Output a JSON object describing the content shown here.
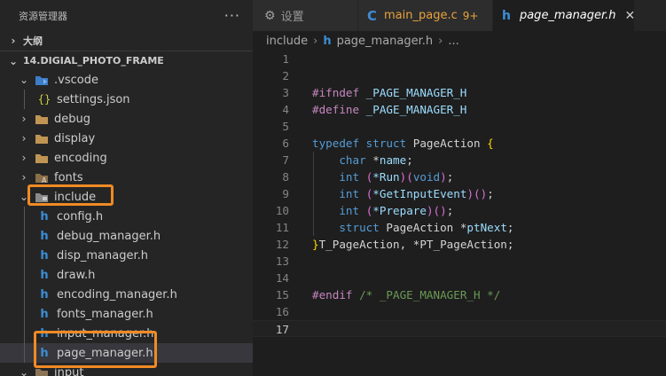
{
  "sidebar": {
    "title": "资源管理器",
    "more": "···",
    "outline_label": "大纲",
    "project_label": "14.DIGIAL_PHOTO_FRAME",
    "items": [
      {
        "label": ".vscode",
        "type": "folder-open",
        "icon": "vscode-folder-icon"
      },
      {
        "label": "settings.json",
        "type": "file",
        "icon": "json-icon",
        "glyph": "{}"
      },
      {
        "label": "debug",
        "type": "folder",
        "icon": "folder-icon"
      },
      {
        "label": "display",
        "type": "folder",
        "icon": "folder-icon"
      },
      {
        "label": "encoding",
        "type": "folder",
        "icon": "folder-icon"
      },
      {
        "label": "fonts",
        "type": "folder",
        "icon": "fonts-folder-icon"
      },
      {
        "label": "include",
        "type": "folder-open",
        "icon": "include-folder-icon"
      },
      {
        "label": "config.h",
        "type": "file",
        "icon": "h-icon"
      },
      {
        "label": "debug_manager.h",
        "type": "file",
        "icon": "h-icon"
      },
      {
        "label": "disp_manager.h",
        "type": "file",
        "icon": "h-icon"
      },
      {
        "label": "draw.h",
        "type": "file",
        "icon": "h-icon"
      },
      {
        "label": "encoding_manager.h",
        "type": "file",
        "icon": "h-icon"
      },
      {
        "label": "fonts_manager.h",
        "type": "file",
        "icon": "h-icon"
      },
      {
        "label": "input_manager.h",
        "type": "file",
        "icon": "h-icon"
      },
      {
        "label": "page_manager.h",
        "type": "file",
        "icon": "h-icon"
      },
      {
        "label": "input",
        "type": "folder-open",
        "icon": "input-folder-icon"
      }
    ]
  },
  "tabs": [
    {
      "label": "设置",
      "icon": "gear-icon"
    },
    {
      "label": "main_page.c",
      "badge": "9+",
      "icon": "c-file-icon"
    },
    {
      "label": "page_manager.h",
      "icon": "h-icon",
      "active": true,
      "close": "✕"
    }
  ],
  "breadcrumb": {
    "folder": "include",
    "file": "page_manager.h",
    "tail": "..."
  },
  "editor": {
    "line_numbers": [
      "1",
      "2",
      "3",
      "4",
      "5",
      "6",
      "7",
      "8",
      "9",
      "10",
      "11",
      "12",
      "13",
      "14",
      "15",
      "16",
      "17"
    ],
    "current_line": "17",
    "lines": [
      [],
      [],
      [
        {
          "t": "#ifndef",
          "c": "mac"
        },
        {
          "t": " _PAGE_MANAGER_H",
          "c": "t-blue"
        }
      ],
      [
        {
          "t": "#define",
          "c": "mac"
        },
        {
          "t": " _PAGE_MANAGER_H",
          "c": "t-blue"
        }
      ],
      [],
      [
        {
          "t": "typedef",
          "c": "type"
        },
        {
          "t": " ",
          "c": "t-plain"
        },
        {
          "t": "struct",
          "c": "type"
        },
        {
          "t": " PageAction ",
          "c": "t-plain"
        },
        {
          "t": "{",
          "c": "t-paren"
        }
      ],
      [
        {
          "t": "    ",
          "c": "t-plain"
        },
        {
          "t": "char",
          "c": "type"
        },
        {
          "t": " *",
          "c": "t-plain"
        },
        {
          "t": "name",
          "c": "t-blue"
        },
        {
          "t": ";",
          "c": "t-plain"
        }
      ],
      [
        {
          "t": "    ",
          "c": "t-plain"
        },
        {
          "t": "int",
          "c": "type"
        },
        {
          "t": " ",
          "c": "t-plain"
        },
        {
          "t": "(",
          "c": "t-brace"
        },
        {
          "t": "*Run",
          "c": "t-blue"
        },
        {
          "t": ")",
          "c": "t-brace"
        },
        {
          "t": "(",
          "c": "t-brace"
        },
        {
          "t": "void",
          "c": "type"
        },
        {
          "t": ")",
          "c": "t-brace"
        },
        {
          "t": ";",
          "c": "t-plain"
        }
      ],
      [
        {
          "t": "    ",
          "c": "t-plain"
        },
        {
          "t": "int",
          "c": "type"
        },
        {
          "t": " ",
          "c": "t-plain"
        },
        {
          "t": "(",
          "c": "t-brace"
        },
        {
          "t": "*GetInputEvent",
          "c": "t-blue"
        },
        {
          "t": ")",
          "c": "t-brace"
        },
        {
          "t": "()",
          "c": "t-brace"
        },
        {
          "t": ";",
          "c": "t-plain"
        }
      ],
      [
        {
          "t": "    ",
          "c": "t-plain"
        },
        {
          "t": "int",
          "c": "type"
        },
        {
          "t": " ",
          "c": "t-plain"
        },
        {
          "t": "(",
          "c": "t-brace"
        },
        {
          "t": "*Prepare",
          "c": "t-blue"
        },
        {
          "t": ")",
          "c": "t-brace"
        },
        {
          "t": "()",
          "c": "t-brace"
        },
        {
          "t": ";",
          "c": "t-plain"
        }
      ],
      [
        {
          "t": "    ",
          "c": "t-plain"
        },
        {
          "t": "struct",
          "c": "type"
        },
        {
          "t": " PageAction *",
          "c": "t-plain"
        },
        {
          "t": "ptNext",
          "c": "t-blue"
        },
        {
          "t": ";",
          "c": "t-plain"
        }
      ],
      [
        {
          "t": "}",
          "c": "t-paren"
        },
        {
          "t": "T_PageAction, *PT_PageAction;",
          "c": "t-plain"
        }
      ],
      [],
      [],
      [
        {
          "t": "#endif",
          "c": "mac"
        },
        {
          "t": " /* _PAGE_MANAGER_H */",
          "c": "t-com"
        }
      ],
      [],
      []
    ]
  },
  "colors": {
    "highlight": "#f08a24",
    "accent": "#3b8ed6"
  }
}
